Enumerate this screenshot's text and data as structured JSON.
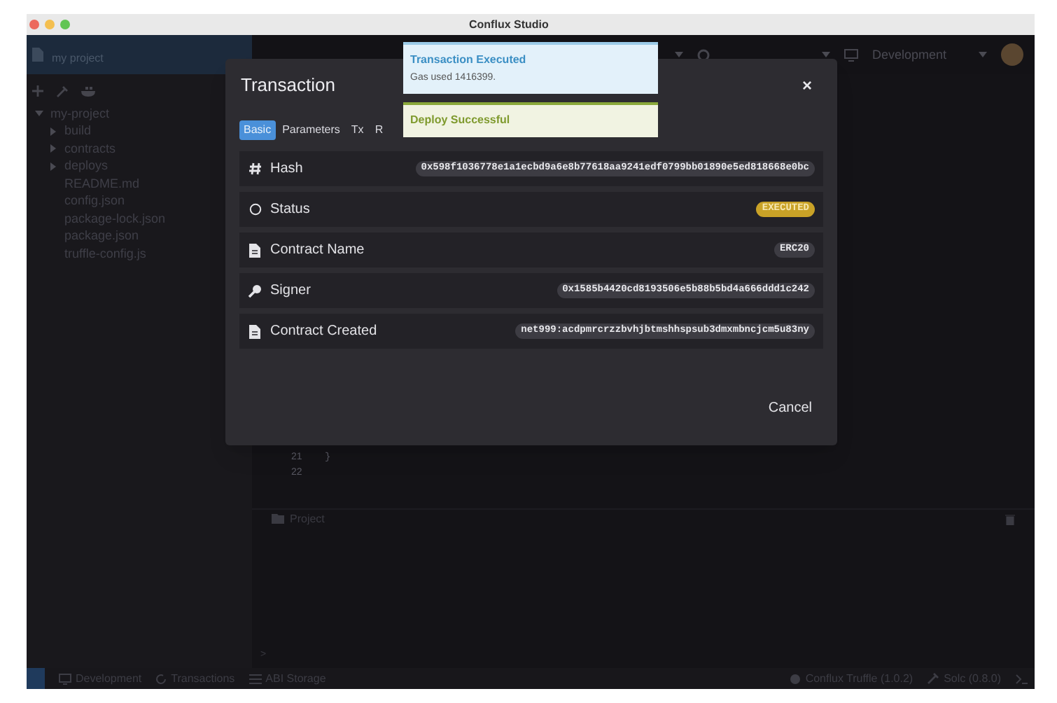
{
  "window": {
    "title": "Conflux Studio"
  },
  "header": {
    "project": "my project",
    "network": "Development"
  },
  "sidebar": {
    "tree": [
      {
        "name": "my-project",
        "kind": "folder",
        "expanded": true,
        "children": [
          {
            "name": "build",
            "kind": "folder",
            "expanded": false
          },
          {
            "name": "contracts",
            "kind": "folder",
            "expanded": false
          },
          {
            "name": "deploys",
            "kind": "folder",
            "expanded": false
          },
          {
            "name": "README.md",
            "kind": "file"
          },
          {
            "name": "config.json",
            "kind": "file"
          },
          {
            "name": "package-lock.json",
            "kind": "file"
          },
          {
            "name": "package.json",
            "kind": "file"
          },
          {
            "name": "truffle-config.js",
            "kind": "file"
          }
        ]
      }
    ]
  },
  "editor": {
    "lines": [
      {
        "number": "21",
        "code": "}"
      },
      {
        "number": "22"
      }
    ]
  },
  "panel": {
    "title": "Project",
    "prompt": ">"
  },
  "status_bar": {
    "left": [
      {
        "kind": "network",
        "label": "Development"
      },
      {
        "kind": "transactions",
        "label": "Transactions"
      },
      {
        "kind": "abi",
        "label": "ABI Storage"
      }
    ],
    "right": [
      {
        "kind": "truffle",
        "label": "Conflux Truffle (1.0.2)"
      },
      {
        "kind": "solc",
        "label": "Solc (0.8.0)"
      }
    ]
  },
  "dialog": {
    "title": "Transaction",
    "close": "×",
    "tabs": [
      {
        "label": "Basic",
        "selected": true
      },
      {
        "label": "Parameters",
        "selected": false
      },
      {
        "label": "Tx",
        "selected": false
      },
      {
        "label": "R",
        "selected": false
      }
    ],
    "rows": [
      {
        "kind": "hash",
        "label": "Hash",
        "value": "0x598f1036778e1a1ecbd9a6e8b77618aa9241edf0799bb01890e5ed818668e0bc",
        "highlighted": false
      },
      {
        "kind": "status",
        "label": "Status",
        "value": "EXECUTED",
        "highlighted": true
      },
      {
        "kind": "file",
        "label": "Contract Name",
        "value": "ERC20",
        "highlighted": false
      },
      {
        "kind": "key",
        "label": "Signer",
        "value": "0x1585b4420cd8193506e5b88b5bd4a666ddd1c242",
        "highlighted": false
      },
      {
        "kind": "file",
        "label": "Contract Created",
        "value": "net999:acdpmrcrzzbvhjbtmshhspsub3dmxmbncjcm5u83ny",
        "highlighted": false
      }
    ],
    "cancel": "Cancel"
  },
  "toasts": [
    {
      "kind": "info",
      "title": "Transaction Executed",
      "text": "Gas used 1416399."
    },
    {
      "kind": "success",
      "title": "Deploy Successful"
    }
  ]
}
